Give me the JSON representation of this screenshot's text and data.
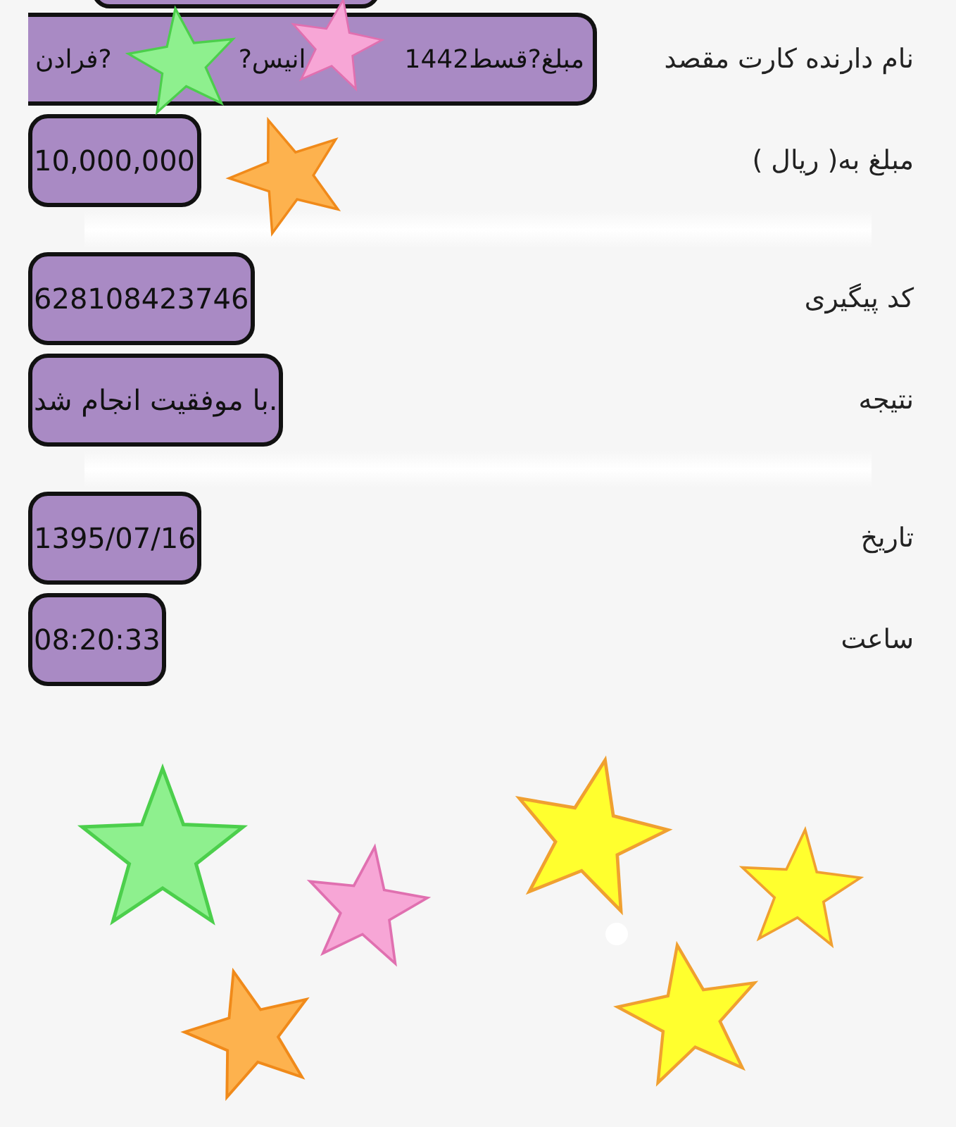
{
  "rows": [
    {
      "label": "نام دارنده کارت مقصد",
      "value_parts": [
        "مبلغ?قسط1442",
        "انیس?",
        "?فرادن"
      ],
      "divider_after": false
    },
    {
      "label": "مبلغ به( ریال )",
      "value_parts": [
        "10,000,000"
      ],
      "divider_after": true
    },
    {
      "label": "کد پیگیری",
      "value_parts": [
        "628108423746"
      ],
      "divider_after": false
    },
    {
      "label": "نتیجه",
      "value_parts": [
        "با موفقیت انجام شد."
      ],
      "divider_after": true
    },
    {
      "label": "تاریخ",
      "value_parts": [
        "1395/07/16"
      ],
      "divider_after": false
    },
    {
      "label": "ساعت",
      "value_parts": [
        "08:20:33"
      ],
      "divider_after": false
    }
  ]
}
